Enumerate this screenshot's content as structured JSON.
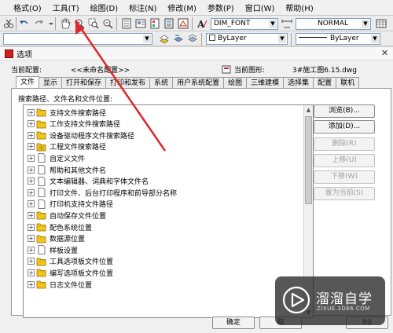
{
  "menubar": {
    "items": [
      "格式(O)",
      "工具(T)",
      "绘图(D)",
      "标注(N)",
      "修改(M)",
      "参数(P)",
      "窗口(W)",
      "帮助(H)"
    ]
  },
  "toolbar": {
    "dim_font": "DIM_FONT",
    "style": "NORMAL",
    "layer": "ByLayer",
    "linetype": "ByLayer"
  },
  "dialog": {
    "title": "选项",
    "current_profile_label": "当前配置:",
    "current_profile_value": "<<未命名配置>>",
    "current_drawing_label": "当前图形:",
    "current_drawing_value": "3#施工图6.15.dwg",
    "tabs": [
      "文件",
      "显示",
      "打开和保存",
      "打印和发布",
      "系统",
      "用户系统配置",
      "绘图",
      "三维建模",
      "选择集",
      "配置",
      "联机"
    ],
    "active_tab": "文件",
    "search_label": "搜索路径、文件名和文件位置:",
    "tree_items": [
      "支持文件搜索路径",
      "工作支持文件搜索路径",
      "设备驱动程序文件搜索路径",
      "工程文件搜索路径",
      "自定义文件",
      "帮助和其他文件名",
      "文本编辑器、词典和字体文件名",
      "打印文件、后台打印程序和前导部分名称",
      "打印机支持文件路径",
      "自动保存文件位置",
      "配色系统位置",
      "数据源位置",
      "样板设置",
      "工具选项板文件位置",
      "编写选项板文件位置",
      "日志文件位置"
    ],
    "side_buttons": {
      "browse": "浏览(B)...",
      "add": "添加(D)...",
      "remove": "删除(R)",
      "move_up": "上移(U)",
      "move_down": "下移(W)",
      "set_current": "置为当前(S)"
    },
    "bottom_buttons": {
      "ok": "确定",
      "cancel": "取",
      "help": "00"
    }
  },
  "watermark": {
    "title": "溜溜自学",
    "subtitle": "ZIXUE.3D66.COM"
  },
  "colors": {
    "annotation_arrow": "#e0262a",
    "folder": "#f5c518",
    "disabled_text": "#a0a0a0"
  }
}
